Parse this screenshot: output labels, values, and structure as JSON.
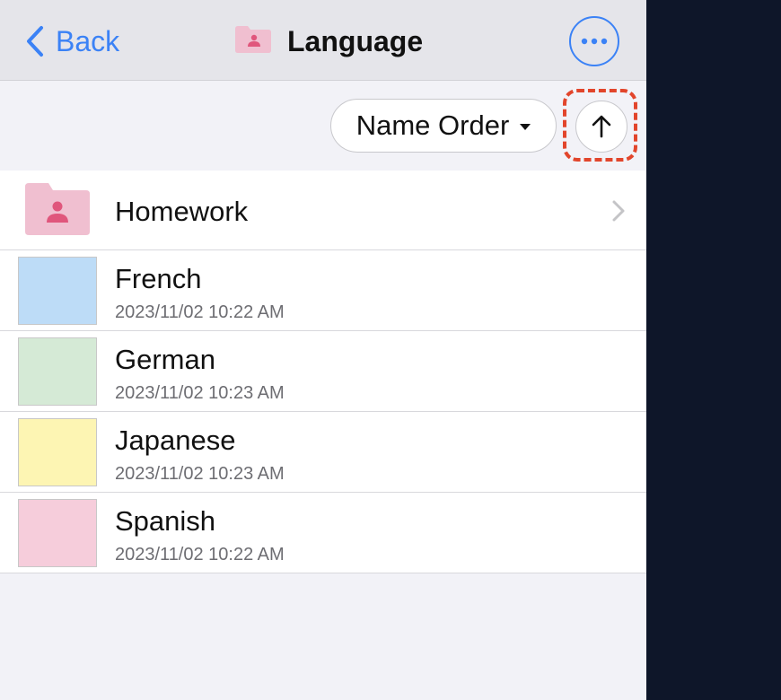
{
  "header": {
    "back_label": "Back",
    "title": "Language"
  },
  "sort": {
    "order_label": "Name Order",
    "direction_icon": "arrow-up-icon"
  },
  "colors": {
    "accent": "#3b82f6",
    "highlight": "#e2452b",
    "folder": "#f0bfd0",
    "folder_person": "#e0567c"
  },
  "items": [
    {
      "type": "folder",
      "name": "Homework"
    },
    {
      "type": "notebook",
      "name": "French",
      "date": "2023/11/02 10:22 AM",
      "color": "#bddcf7"
    },
    {
      "type": "notebook",
      "name": "German",
      "date": "2023/11/02 10:23 AM",
      "color": "#d5ead6"
    },
    {
      "type": "notebook",
      "name": "Japanese",
      "date": "2023/11/02 10:23 AM",
      "color": "#fdf5b3"
    },
    {
      "type": "notebook",
      "name": "Spanish",
      "date": "2023/11/02 10:22 AM",
      "color": "#f6cddb"
    }
  ]
}
